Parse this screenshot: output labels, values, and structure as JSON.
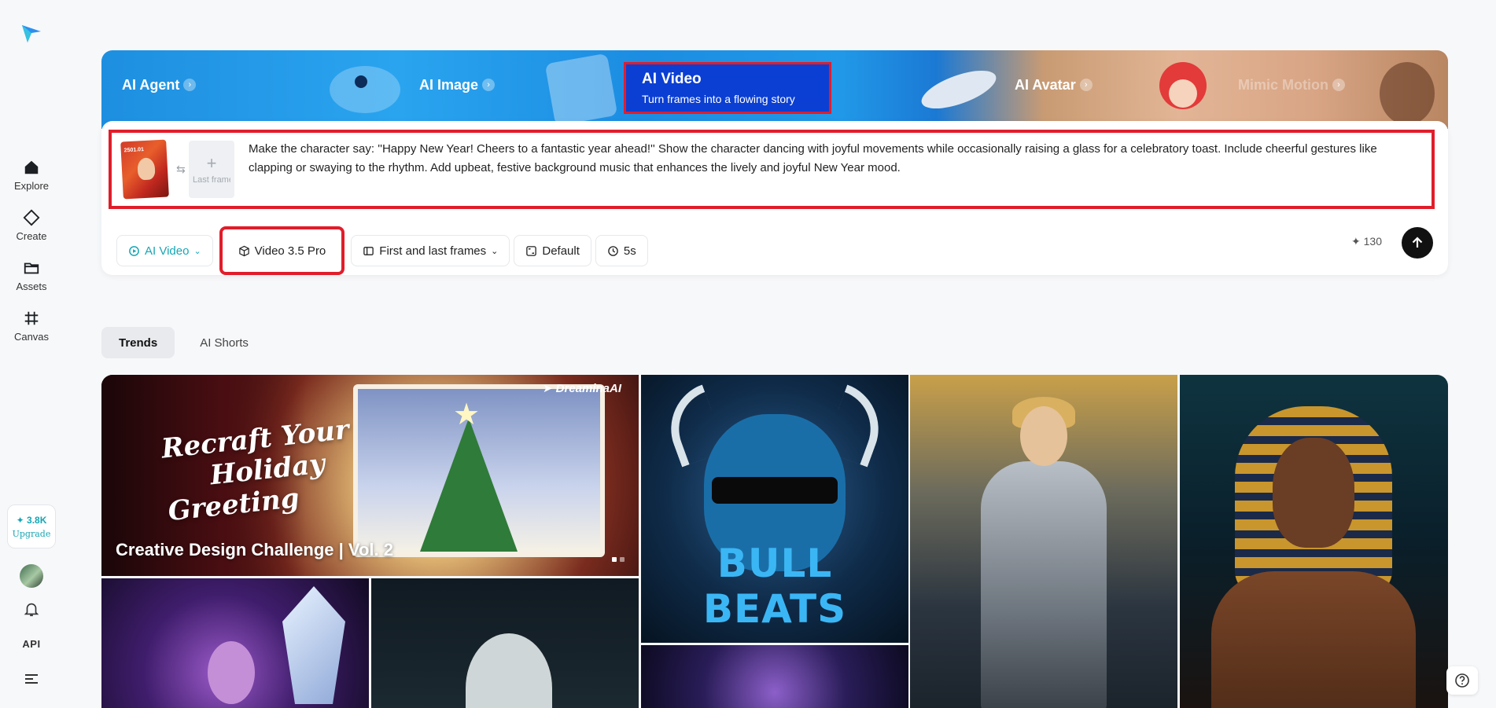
{
  "sidebar": {
    "items": [
      {
        "label": "Explore",
        "icon": "home-icon"
      },
      {
        "label": "Create",
        "icon": "diamond-icon"
      },
      {
        "label": "Assets",
        "icon": "folder-icon"
      },
      {
        "label": "Canvas",
        "icon": "crop-icon"
      }
    ],
    "credits": {
      "amount": "3.8K",
      "upgrade_label": "Upgrade"
    },
    "api_label": "API"
  },
  "banner": {
    "tabs": [
      {
        "label": "AI Agent"
      },
      {
        "label": "AI Image"
      },
      {
        "label": "AI Video",
        "subtitle": "Turn frames into a flowing story",
        "active": true
      },
      {
        "label": "AI Avatar"
      },
      {
        "label": "Mimic Motion"
      }
    ]
  },
  "prompt": {
    "last_frame_label": "Last frame",
    "text": "Make the character say: ''Happy New Year! Cheers to a fantastic year ahead!'' Show the character dancing with joyful movements while occasionally raising a glass for a celebratory toast. Include cheerful gestures like clapping or swaying to the rhythm. Add upbeat, festive background music that enhances the lively and joyful New Year mood.",
    "thumb_text": "2501.01"
  },
  "controls": {
    "mode": "AI Video",
    "model": "Video 3.5 Pro",
    "frames": "First and last frames",
    "ratio": "Default",
    "duration": "5s",
    "cost": "130"
  },
  "feed": {
    "tabs": [
      "Trends",
      "AI Shorts"
    ],
    "hero": {
      "brand": "DreaminaAI",
      "headline_lines": [
        "Recraft Your",
        "Holiday",
        "Greeting"
      ],
      "caption": "Creative Design Challenge | Vol. 2"
    },
    "bull_title": "BULL BEATS"
  },
  "colors": {
    "accent": "#17a6b5",
    "highlight": "#e11d2a",
    "active_tab": "#0b3fd3"
  }
}
